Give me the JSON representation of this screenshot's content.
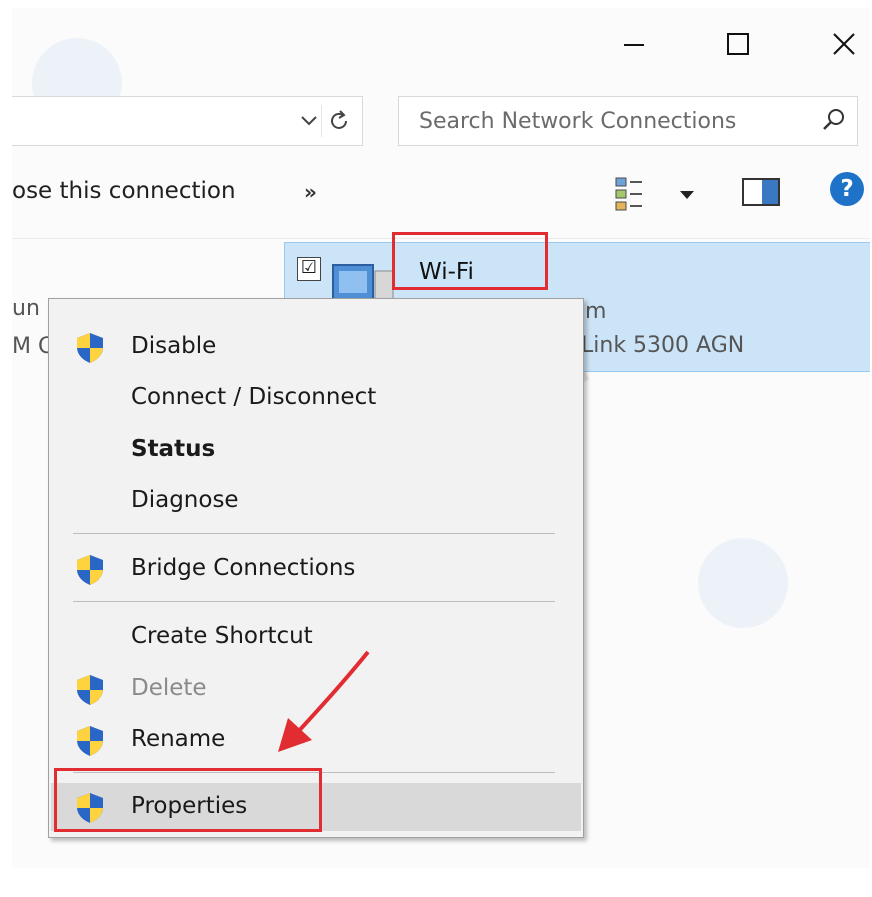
{
  "window": {
    "minimize_icon": "minimize-icon",
    "maximize_icon": "maximize-icon",
    "close_icon": "close-icon"
  },
  "address_bar": {
    "dropdown_icon": "chevron-down-icon",
    "refresh_icon": "refresh-icon"
  },
  "search": {
    "placeholder": "Search Network Connections",
    "icon": "search-icon"
  },
  "command_bar": {
    "action_label": "ose this connection",
    "more_label": "»",
    "view_icon": "change-view-icon",
    "view_dropdown_icon": "dropdown-arrow-icon",
    "preview_pane_icon": "preview-pane-icon",
    "help_label": "?"
  },
  "left_connection": {
    "line1": "un",
    "line2": "M C"
  },
  "wifi_item": {
    "name": "Wi-Fi",
    "status_fragment": "m",
    "device_fragment": "Link 5300 AGN",
    "checked": "☑"
  },
  "context_menu": {
    "items": [
      {
        "label": "Disable",
        "icon": "shield-icon"
      },
      {
        "label": "Connect / Disconnect"
      },
      {
        "label": "Status",
        "bold": true
      },
      {
        "label": "Diagnose"
      },
      {
        "label": "Bridge Connections",
        "icon": "shield-icon"
      },
      {
        "label": "Create Shortcut"
      },
      {
        "label": "Delete",
        "icon": "shield-icon",
        "disabled": true
      },
      {
        "label": "Rename",
        "icon": "shield-icon"
      },
      {
        "label": "Properties",
        "icon": "shield-icon",
        "highlighted": true
      }
    ]
  },
  "colors": {
    "selection_bg": "#cce4f7",
    "highlight_box": "#e12c32",
    "help_blue": "#1e73c8"
  }
}
